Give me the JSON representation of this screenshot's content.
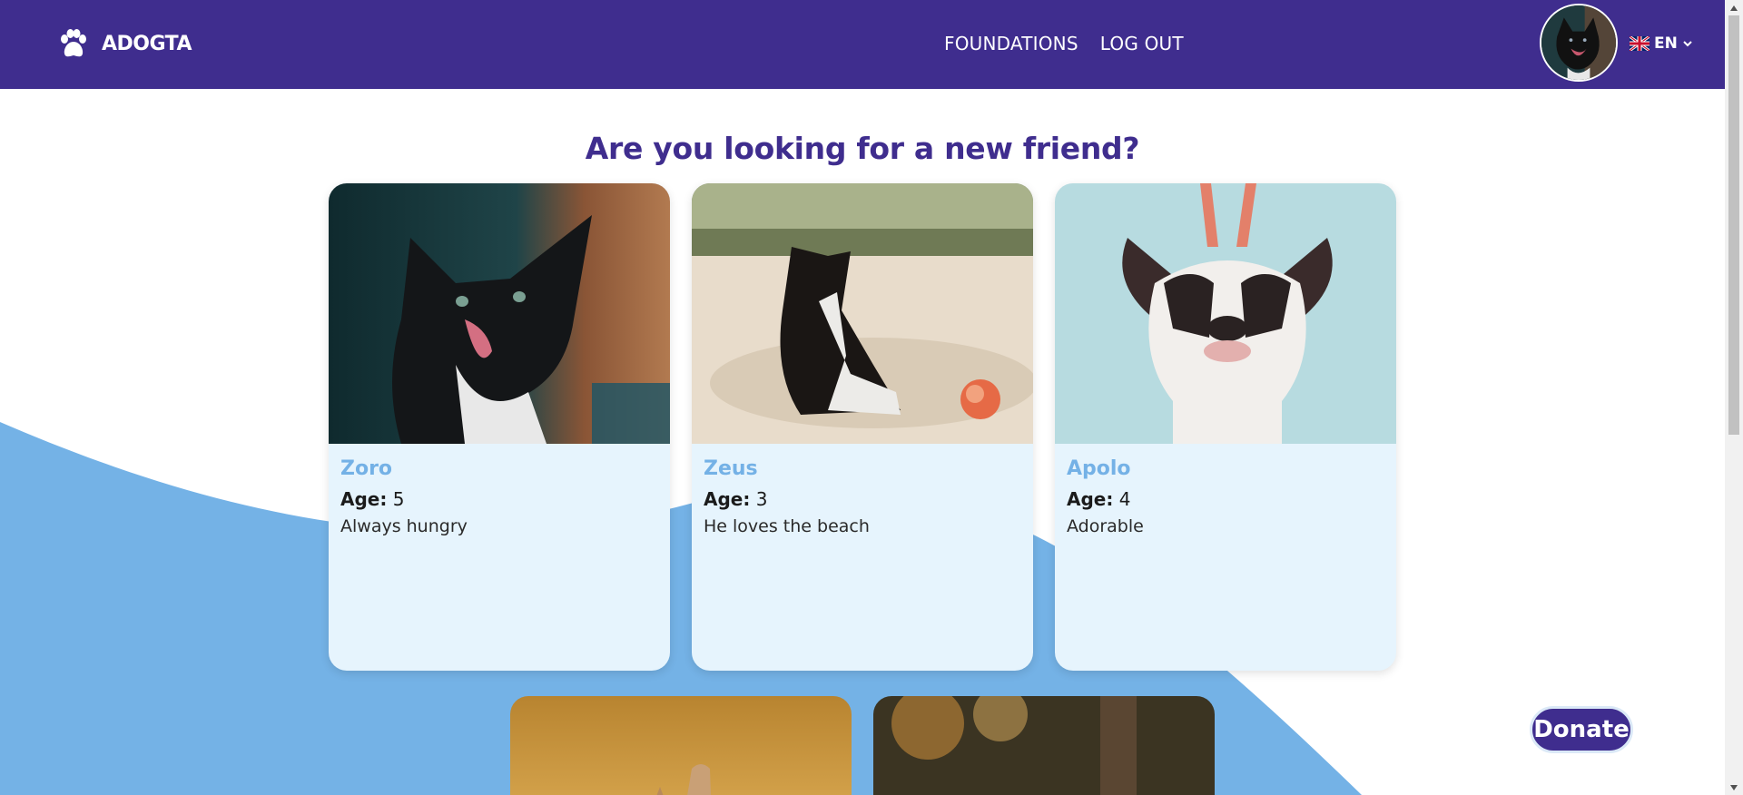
{
  "brand": {
    "name": "ADOGTA",
    "icon": "paw-icon"
  },
  "nav": {
    "foundations": "FOUNDATIONS",
    "logout": "LOG OUT"
  },
  "language": {
    "code": "EN",
    "icon": "uk-flag-icon"
  },
  "main": {
    "title": "Are you looking for a new friend?"
  },
  "pets": [
    {
      "name": "Zoro",
      "age_label": "Age:",
      "age": "5",
      "description": "Always hungry"
    },
    {
      "name": "Zeus",
      "age_label": "Age:",
      "age": "3",
      "description": "He loves the beach"
    },
    {
      "name": "Apolo",
      "age_label": "Age:",
      "age": "4",
      "description": "Adorable"
    }
  ],
  "donate": {
    "label": "Donate"
  },
  "colors": {
    "primary": "#3f2d8e",
    "accent_blue": "#74b1e6",
    "card_bg": "#e6f4fd"
  }
}
